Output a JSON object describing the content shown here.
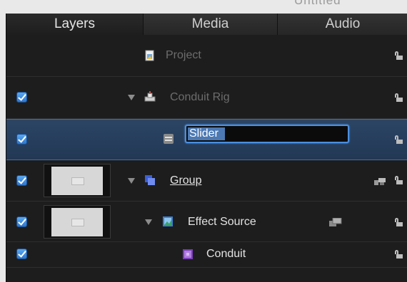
{
  "header_fragment": "Untitled",
  "tabs": [
    {
      "label": "Layers",
      "active": true
    },
    {
      "label": "Media",
      "active": false
    },
    {
      "label": "Audio",
      "active": false
    }
  ],
  "layers": [
    {
      "name": "Project",
      "checked": false,
      "icon": "project-icon"
    },
    {
      "name": "Conduit Rig",
      "checked": true,
      "icon": "rig-icon"
    },
    {
      "name": "Slider",
      "checked": true,
      "icon": "slider-widget-icon",
      "editing": true
    },
    {
      "name": "Group",
      "checked": true,
      "icon": "group-icon"
    },
    {
      "name": "Effect Source",
      "checked": true,
      "icon": "effect-source-icon"
    },
    {
      "name": "Conduit",
      "checked": true,
      "icon": "conduit-icon"
    }
  ],
  "colors": {
    "panel_bg": "#1d1d1d",
    "selection": "#2c4565",
    "checkbox": "#3e8ce3",
    "field_border": "#4b8fe0"
  }
}
